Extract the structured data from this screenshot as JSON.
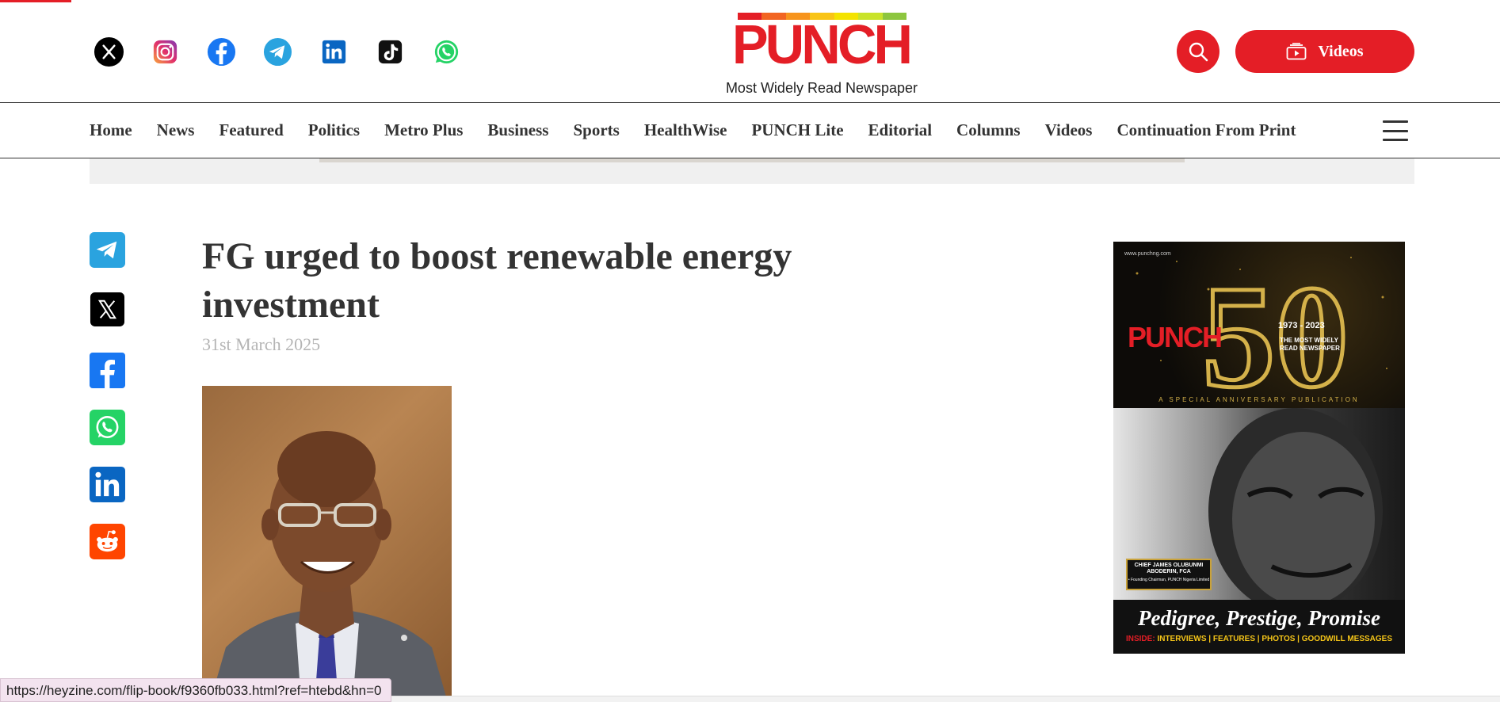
{
  "header": {
    "logo_text": "PUNCH",
    "tagline": "Most Widely Read Newspaper",
    "videos_label": "Videos",
    "logo_bar_colors": [
      "#e41e26",
      "#f7941d",
      "#f9c416",
      "#f4e300",
      "#c9e32a",
      "#8dc63f"
    ],
    "social_icons": [
      "x-icon",
      "instagram-icon",
      "facebook-icon",
      "telegram-icon",
      "linkedin-icon",
      "tiktok-icon",
      "whatsapp-icon"
    ]
  },
  "nav": {
    "items": [
      "Home",
      "News",
      "Featured",
      "Politics",
      "Metro Plus",
      "Business",
      "Sports",
      "HealthWise",
      "PUNCH Lite",
      "Editorial",
      "Columns",
      "Videos",
      "Continuation From Print"
    ]
  },
  "article": {
    "title": "FG urged to boost renewable energy investment",
    "date": "31st March 2025",
    "share_icons": [
      "telegram-icon",
      "x-icon",
      "facebook-icon",
      "whatsapp-icon",
      "linkedin-icon",
      "reddit-icon"
    ]
  },
  "sidebar_ad": {
    "url": "www.punchng.com",
    "punch": "PUNCH",
    "years": "1973 - 2023",
    "most_widely": "THE MOST WIDELY READ NEWSPAPER",
    "special": "A SPECIAL ANNIVERSARY PUBLICATION",
    "name": "CHIEF JAMES OLUBUNMI ABODERIN, FCA",
    "name_sub": "• Founding Chairman, PUNCH Nigeria Limited",
    "slogan": "Pedigree, Prestige, Promise",
    "inside_label": "INSIDE:",
    "inside_items": "INTERVIEWS | FEATURES | PHOTOS | GOODWILL MESSAGES"
  },
  "status_bar": {
    "url": "https://heyzine.com/flip-book/f9360fb033.html?ref=htebd&hn=0"
  },
  "colors": {
    "brand_red": "#e41e26",
    "text_dark": "#333333",
    "date_gray": "#b5b5b5"
  }
}
